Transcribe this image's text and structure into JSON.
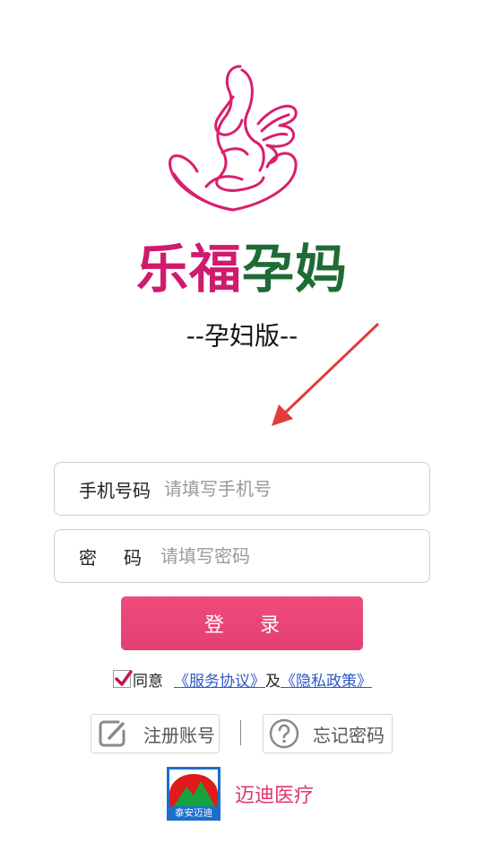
{
  "app": {
    "brand_part1": "乐福",
    "brand_part2": "孕妈",
    "subtitle": "--孕妇版--",
    "brand_colors": {
      "primary": "#d01a6d",
      "secondary": "#1f6b35"
    }
  },
  "form": {
    "phone_label": "手机号码",
    "phone_placeholder": "请填写手机号",
    "password_label_1": "密",
    "password_label_2": "码",
    "password_placeholder": "请填写密码",
    "login_label": "登录",
    "login_color": "#ef4c7c"
  },
  "agreement": {
    "checked": true,
    "agree_text": "同意",
    "service_link": "《服务协议》",
    "and_text": "及",
    "privacy_link": "《隐私政策》"
  },
  "actions": {
    "register_label": "注册账号",
    "register_icon": "edit-icon",
    "forgot_label": "忘记密码",
    "forgot_icon": "question-icon"
  },
  "footer": {
    "logo_text": "泰安迈迪",
    "company_name": "迈迪医疗"
  }
}
